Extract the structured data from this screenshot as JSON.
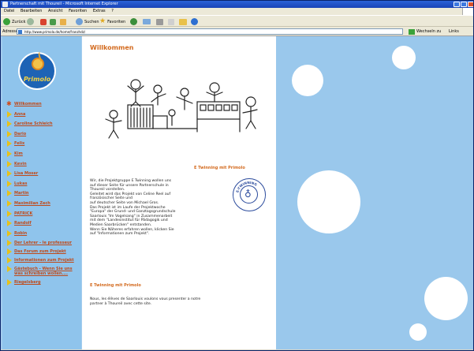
{
  "window": {
    "title": "Partnerschaft mit Thoureil - Microsoft Internet Explorer"
  },
  "menu": [
    "Datei",
    "Bearbeiten",
    "Ansicht",
    "Favoriten",
    "Extras",
    "?"
  ],
  "toolbar": {
    "back_label": "Zurück",
    "search_label": "Suchen",
    "favorites_label": "Favoriten"
  },
  "address": {
    "label": "Adresse",
    "url": "http://www.primolo.de/home/franzhdz/",
    "go_label": "Wechseln zu",
    "links_label": "Links"
  },
  "logo": {
    "text": "Primolo"
  },
  "nav": [
    {
      "label": "Willkommen",
      "icon": "star-icon"
    },
    {
      "label": "Anna",
      "icon": "triangle-icon"
    },
    {
      "label": "Caroline Schleich",
      "icon": "triangle-icon"
    },
    {
      "label": "Dario",
      "icon": "triangle-icon"
    },
    {
      "label": "Felix",
      "icon": "triangle-icon"
    },
    {
      "label": "Kim",
      "icon": "triangle-icon"
    },
    {
      "label": "Kevin",
      "icon": "triangle-icon"
    },
    {
      "label": "Lisa Moser",
      "icon": "triangle-icon"
    },
    {
      "label": "Lukas",
      "icon": "triangle-icon"
    },
    {
      "label": "Martin",
      "icon": "triangle-icon"
    },
    {
      "label": "Maximilian Zech",
      "icon": "triangle-icon"
    },
    {
      "label": "PATRICK",
      "icon": "triangle-icon"
    },
    {
      "label": "Randolf",
      "icon": "triangle-icon"
    },
    {
      "label": "Robin",
      "icon": "triangle-icon"
    },
    {
      "label": "Der Lehrer - le professeur",
      "icon": "triangle-icon"
    },
    {
      "label": "Das Forum zum Projekt",
      "icon": "triangle-icon"
    },
    {
      "label": "Informationen zum Projekt",
      "icon": "triangle-icon"
    },
    {
      "label": "Gästebuch - Wenn Sie uns was schreiben wollen....",
      "icon": "triangle-icon"
    },
    {
      "label": "Riegelsberg",
      "icon": "triangle-icon"
    }
  ],
  "main": {
    "title": "Willkommen",
    "heading1": "E Twinning mit Primolo",
    "paragraph1": "Wir, die Projektgruppe E Twinning wollen uns\nauf dieser Seite für unsere Partnerschule in\nThoureil vorstellen.\nGeleitet wird das Projekt von Celine Reel auf\nfranzösischer Seite und\nauf deutscher Seite von Michael Gros.\nDas Projekt ist im Laufe der Projektwoche\n\"Europa\" der Grund- und Ganztagsgrundschule\nSaarlouis \"Im Vogelsang\" in Zusammenarbeit\nmit dem \"Landesinstitut für Pädagogik und\nMedien Saarbrücken\" entstanden.\nWenn Sie Näheres erfahren wollen, klicken Sie\nauf \"Informationen zum Projekt\".",
    "heading2": "E Twinning mit Primolo",
    "paragraph2": "Nous, les élèves de Saarlouis voulons vous presenter a notre\npartner à Thoureil avec cette site.",
    "seal_text": "E-TWINNING"
  },
  "colors": {
    "accent": "#d36a1e",
    "sidebar_bg": "#8fc4ec",
    "page_bg": "#a3ccee"
  }
}
